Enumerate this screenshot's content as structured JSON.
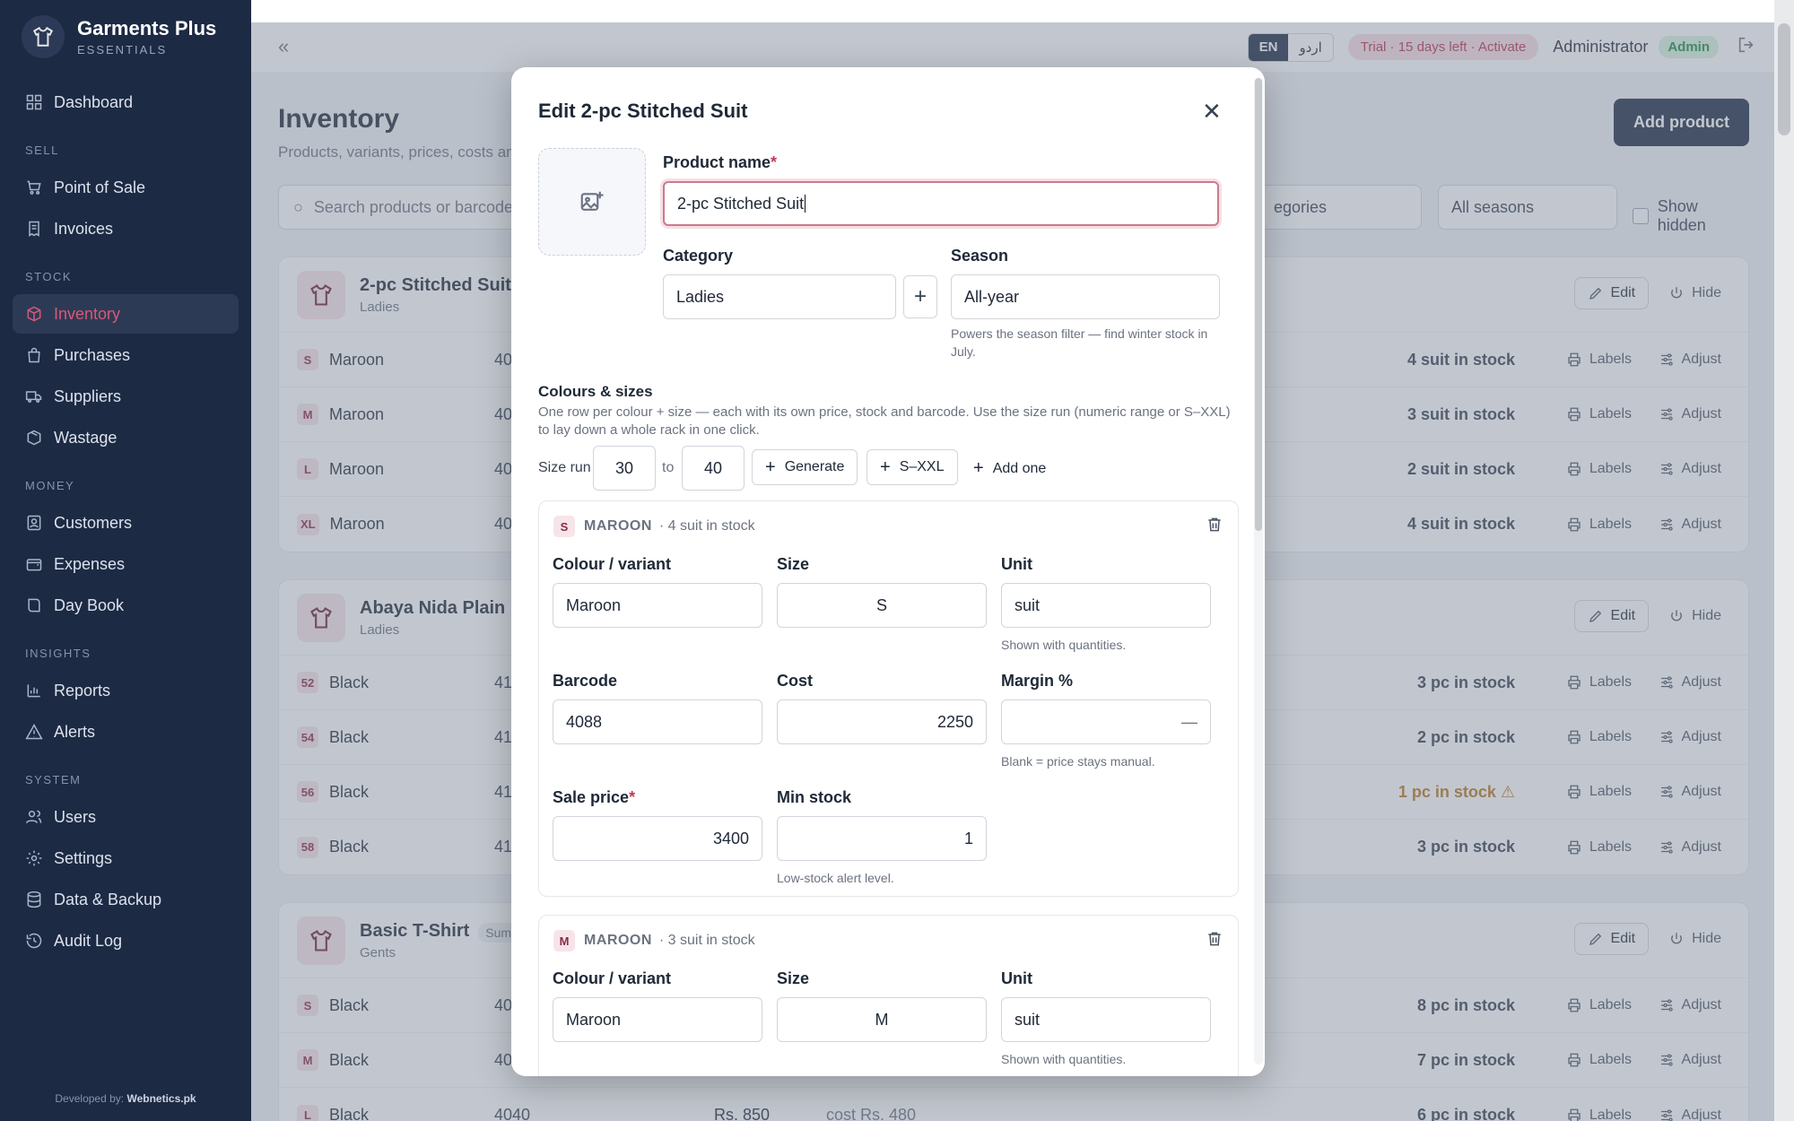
{
  "brand": {
    "name": "Garments Plus",
    "sub": "ESSENTIALS"
  },
  "nav": {
    "dashboard": "Dashboard",
    "sec_sell": "SELL",
    "pos": "Point of Sale",
    "invoices": "Invoices",
    "sec_stock": "STOCK",
    "inventory": "Inventory",
    "purchases": "Purchases",
    "suppliers": "Suppliers",
    "wastage": "Wastage",
    "sec_money": "MONEY",
    "customers": "Customers",
    "expenses": "Expenses",
    "daybook": "Day Book",
    "sec_insights": "INSIGHTS",
    "reports": "Reports",
    "alerts": "Alerts",
    "sec_system": "SYSTEM",
    "users": "Users",
    "settings": "Settings",
    "backup": "Data & Backup",
    "audit": "Audit Log"
  },
  "developer": {
    "prefix": "Developed by:",
    "name": "Webnetics.pk"
  },
  "topbar": {
    "lang_en": "EN",
    "lang_ur": "اردو",
    "trial": "Trial · 15 days left · Activate",
    "user": "Administrator",
    "role": "Admin"
  },
  "page": {
    "title": "Inventory",
    "subtitle": "Products, variants, prices, costs and",
    "add_product": "Add product",
    "search_placeholder": "Search products or barcode",
    "categories": "egories",
    "seasons": "All seasons",
    "show_hidden": "Show hidden"
  },
  "products": [
    {
      "name": "2-pc Stitched Suit",
      "category": "Ladies",
      "variants": [
        {
          "size": "S",
          "color": "Maroon",
          "code": "40",
          "stock": "4 suit in stock"
        },
        {
          "size": "M",
          "color": "Maroon",
          "code": "40",
          "stock": "3 suit in stock"
        },
        {
          "size": "L",
          "color": "Maroon",
          "code": "40",
          "stock": "2 suit in stock"
        },
        {
          "size": "XL",
          "color": "Maroon",
          "code": "40",
          "stock": "4 suit in stock"
        }
      ]
    },
    {
      "name": "Abaya Nida Plain",
      "category": "Ladies",
      "variants": [
        {
          "size": "52",
          "color": "Black",
          "code": "41",
          "stock": "3 pc in stock"
        },
        {
          "size": "54",
          "color": "Black",
          "code": "41",
          "stock": "2 pc in stock"
        },
        {
          "size": "56",
          "color": "Black",
          "code": "41",
          "stock": "1 pc in stock ⚠"
        },
        {
          "size": "58",
          "color": "Black",
          "code": "41",
          "stock": "3 pc in stock"
        }
      ]
    },
    {
      "name": "Basic T-Shirt",
      "badge": "Sum",
      "category": "Gents",
      "variants": [
        {
          "size": "S",
          "color": "Black",
          "code": "40",
          "stock": "8 pc in stock"
        },
        {
          "size": "M",
          "color": "Black",
          "code": "40",
          "stock": "7 pc in stock"
        },
        {
          "size": "L",
          "color": "Black",
          "code": "4040",
          "price": "Rs. 850",
          "cost": "cost Rs. 480",
          "stock": "6 pc in stock"
        }
      ]
    }
  ],
  "actions": {
    "edit": "Edit",
    "hide": "Hide",
    "labels": "Labels",
    "adjust": "Adjust"
  },
  "modal": {
    "title": "Edit 2-pc Stitched Suit",
    "product_name_label": "Product name",
    "required": "*",
    "product_name": "2-pc Stitched Suit",
    "category_label": "Category",
    "category": "Ladies",
    "season_label": "Season",
    "season": "All-year",
    "season_hint": "Powers the season filter — find winter stock in July.",
    "colours_title": "Colours & sizes",
    "colours_desc": "One row per colour + size — each with its own price, stock and barcode. Use the size run (numeric range or S–XXL) to lay down a whole rack in one click.",
    "size_run_label": "Size run",
    "size_from": "30",
    "size_to_label": "to",
    "size_to": "40",
    "generate": "Generate",
    "s_xxl": "S–XXL",
    "add_one": "Add one",
    "labels": {
      "colour": "Colour / variant",
      "size": "Size",
      "unit": "Unit",
      "unit_hint": "Shown with quantities.",
      "barcode": "Barcode",
      "cost": "Cost",
      "margin": "Margin %",
      "margin_hint": "Blank = price stays manual.",
      "sale_price": "Sale price",
      "min_stock": "Min stock",
      "min_hint": "Low-stock alert level."
    },
    "variants": [
      {
        "tag": "S",
        "color_upper": "MAROON",
        "stock": "· 4 suit in stock",
        "colour": "Maroon",
        "size": "S",
        "unit": "suit",
        "barcode": "4088",
        "cost": "2250",
        "margin": "—",
        "sale_price": "3400",
        "min_stock": "1"
      },
      {
        "tag": "M",
        "color_upper": "MAROON",
        "stock": "· 3 suit in stock",
        "colour": "Maroon",
        "size": "M",
        "unit": "suit"
      }
    ]
  }
}
